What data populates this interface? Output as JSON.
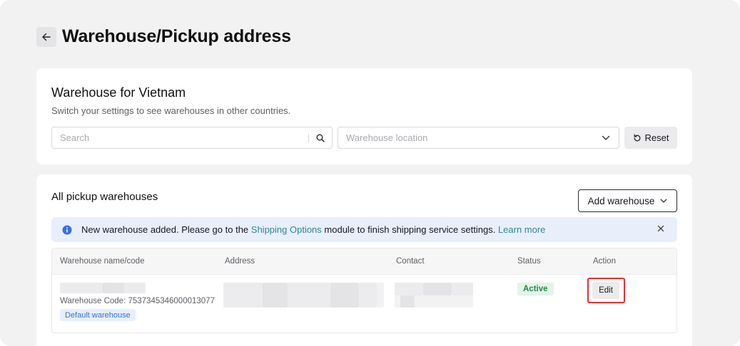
{
  "header": {
    "back_icon": "arrow-left-icon",
    "title": "Warehouse/Pickup address"
  },
  "filters": {
    "title": "Warehouse for Vietnam",
    "subtitle": "Switch your settings to see warehouses in other countries.",
    "search_placeholder": "Search",
    "search_value": "",
    "search_icon": "search-icon",
    "location_placeholder": "Warehouse location",
    "location_icon": "chevron-down-icon",
    "reset_label": "Reset",
    "reset_icon": "reset-icon"
  },
  "warehouses": {
    "title": "All pickup warehouses",
    "add_label": "Add warehouse",
    "banner": {
      "text_before": "New warehouse added. Please go to the ",
      "link_shipping": "Shipping Options",
      "text_after": " module to finish shipping service settings. ",
      "link_learn": "Learn more",
      "info_icon": "info-icon",
      "close_icon": "close-icon"
    },
    "columns": [
      "Warehouse name/code",
      "Address",
      "Contact",
      "Status",
      "Action"
    ],
    "rows": [
      {
        "name": "",
        "code_text": "Warehouse Code: 7537345346000013077",
        "badge": "Default warehouse",
        "address": "",
        "contact": "",
        "status": "Active",
        "action": "Edit"
      }
    ]
  },
  "colors": {
    "page_bg": "#f2f2f3",
    "link": "#2d8a8a",
    "active_green": "#1f8a45",
    "highlight_red": "#e5302f",
    "banner_bg": "#e9eefb"
  }
}
